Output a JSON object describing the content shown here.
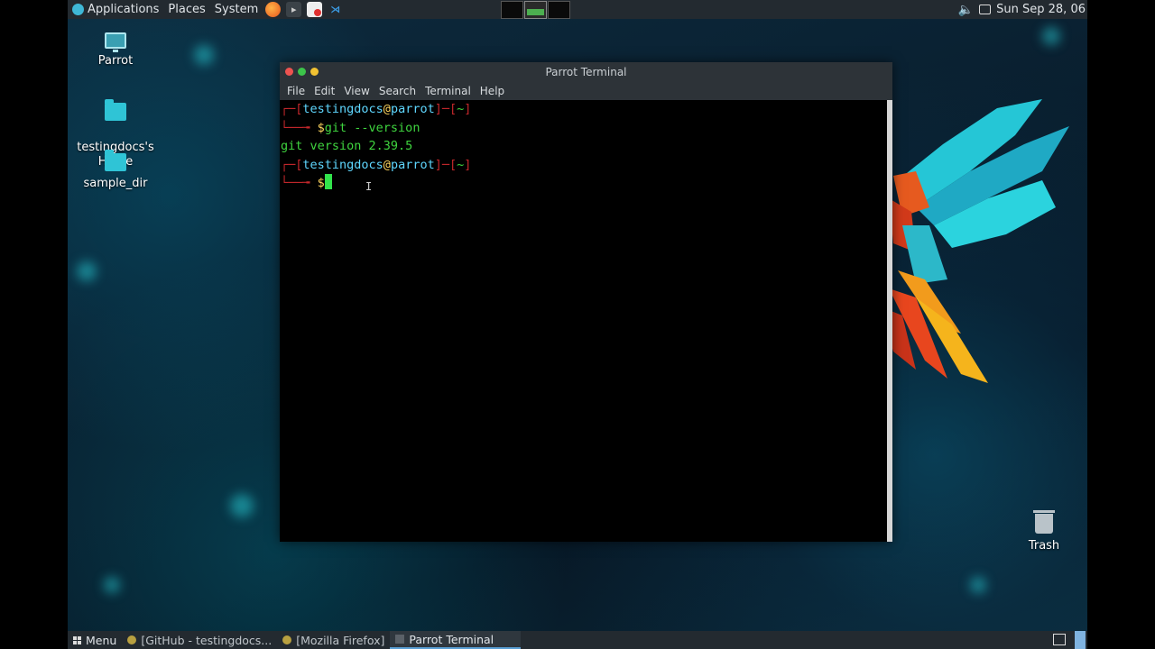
{
  "top_panel": {
    "applications": "Applications",
    "places": "Places",
    "system": "System",
    "launchers": [
      "firefox-icon",
      "terminal-icon",
      "no-entry-icon",
      "vscode-icon"
    ],
    "clock": "Sun Sep 28, 06"
  },
  "desktop": {
    "icons": [
      {
        "label": "Parrot"
      },
      {
        "label": "testingdocs's\nHome"
      },
      {
        "label": "sample_dir"
      },
      {
        "label": "Trash"
      }
    ]
  },
  "terminal": {
    "title": "Parrot Terminal",
    "menu": [
      "File",
      "Edit",
      "View",
      "Search",
      "Terminal",
      "Help"
    ],
    "prompt_open": "┌─[",
    "user": "testingdocs",
    "at": "@",
    "host": "parrot",
    "prompt_mid": "]─[",
    "dir": "~",
    "prompt_close": "]",
    "prompt_arrow": "└──╼ ",
    "dollar": "$",
    "command": "git --version",
    "output": "git version 2.39.5",
    "ibeam": "I"
  },
  "bottom_panel": {
    "menu": "Menu",
    "tasks": [
      "[GitHub - testingdocs...",
      "[Mozilla Firefox]",
      "Parrot Terminal"
    ]
  },
  "colors": {
    "accent": "#5aa0d6",
    "prompt_red": "#c3272b",
    "prompt_cyan": "#5fd7ff",
    "prompt_yellow": "#ffd75f",
    "output_green": "#3fd53f"
  }
}
